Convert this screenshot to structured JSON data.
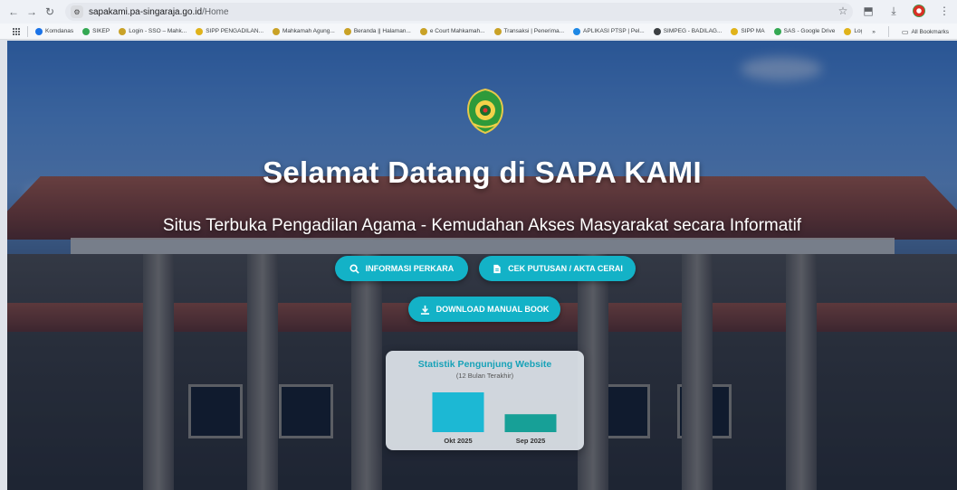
{
  "browser": {
    "url_host": "sapakami.pa-singaraja.go.id",
    "url_path": "/Home",
    "bookmarks": [
      {
        "label": "Komdanas",
        "color": "#1a73e8"
      },
      {
        "label": "SIKEP",
        "color": "#34a853"
      },
      {
        "label": "Login - SSO – Mahk...",
        "color": "#c9a227"
      },
      {
        "label": "SIPP PENGADILAN...",
        "color": "#e0b31b"
      },
      {
        "label": "Mahkamah Agung...",
        "color": "#c9a227"
      },
      {
        "label": "Beranda || Halaman...",
        "color": "#c9a227"
      },
      {
        "label": "e Court Mahkamah...",
        "color": "#c9a227"
      },
      {
        "label": "Transaksi | Penerima...",
        "color": "#c9a227"
      },
      {
        "label": "APLIKASI PTSP | Pel...",
        "color": "#1e88e5"
      },
      {
        "label": "SIMPEG - BADILAG...",
        "color": "#3c4043"
      },
      {
        "label": "SIPP MA",
        "color": "#e0b31b"
      },
      {
        "label": "SAS - Google Drive",
        "color": "#34a853"
      },
      {
        "label": "Login",
        "color": "#e0b31b"
      }
    ],
    "more_label": "»",
    "all_bookmarks": "All Bookmarks"
  },
  "hero": {
    "title": "Selamat Datang di SAPA KAMI",
    "subtitle": "Situs Terbuka Pengadilan Agama - Kemudahan Akses Masyarakat secara Informatif",
    "btn_informasi": "INFORMASI PERKARA",
    "btn_cek": "CEK PUTUSAN / AKTA CERAI",
    "btn_download": "DOWNLOAD MANUAL BOOK"
  },
  "stats": {
    "title": "Statistik Pengunjung Website",
    "subtitle": "(12 Bulan Terakhir)"
  },
  "chart_data": {
    "type": "bar",
    "title": "Statistik Pengunjung Website",
    "subtitle": "(12 Bulan Terakhir)",
    "categories": [
      "Okt 2025",
      "Sep 2025"
    ],
    "values": [
      100,
      45
    ],
    "colors": [
      "#1cb8d4",
      "#17a097"
    ],
    "xlabel": "",
    "ylabel": "",
    "grid": false
  },
  "colors": {
    "accent": "#13b2c7"
  }
}
